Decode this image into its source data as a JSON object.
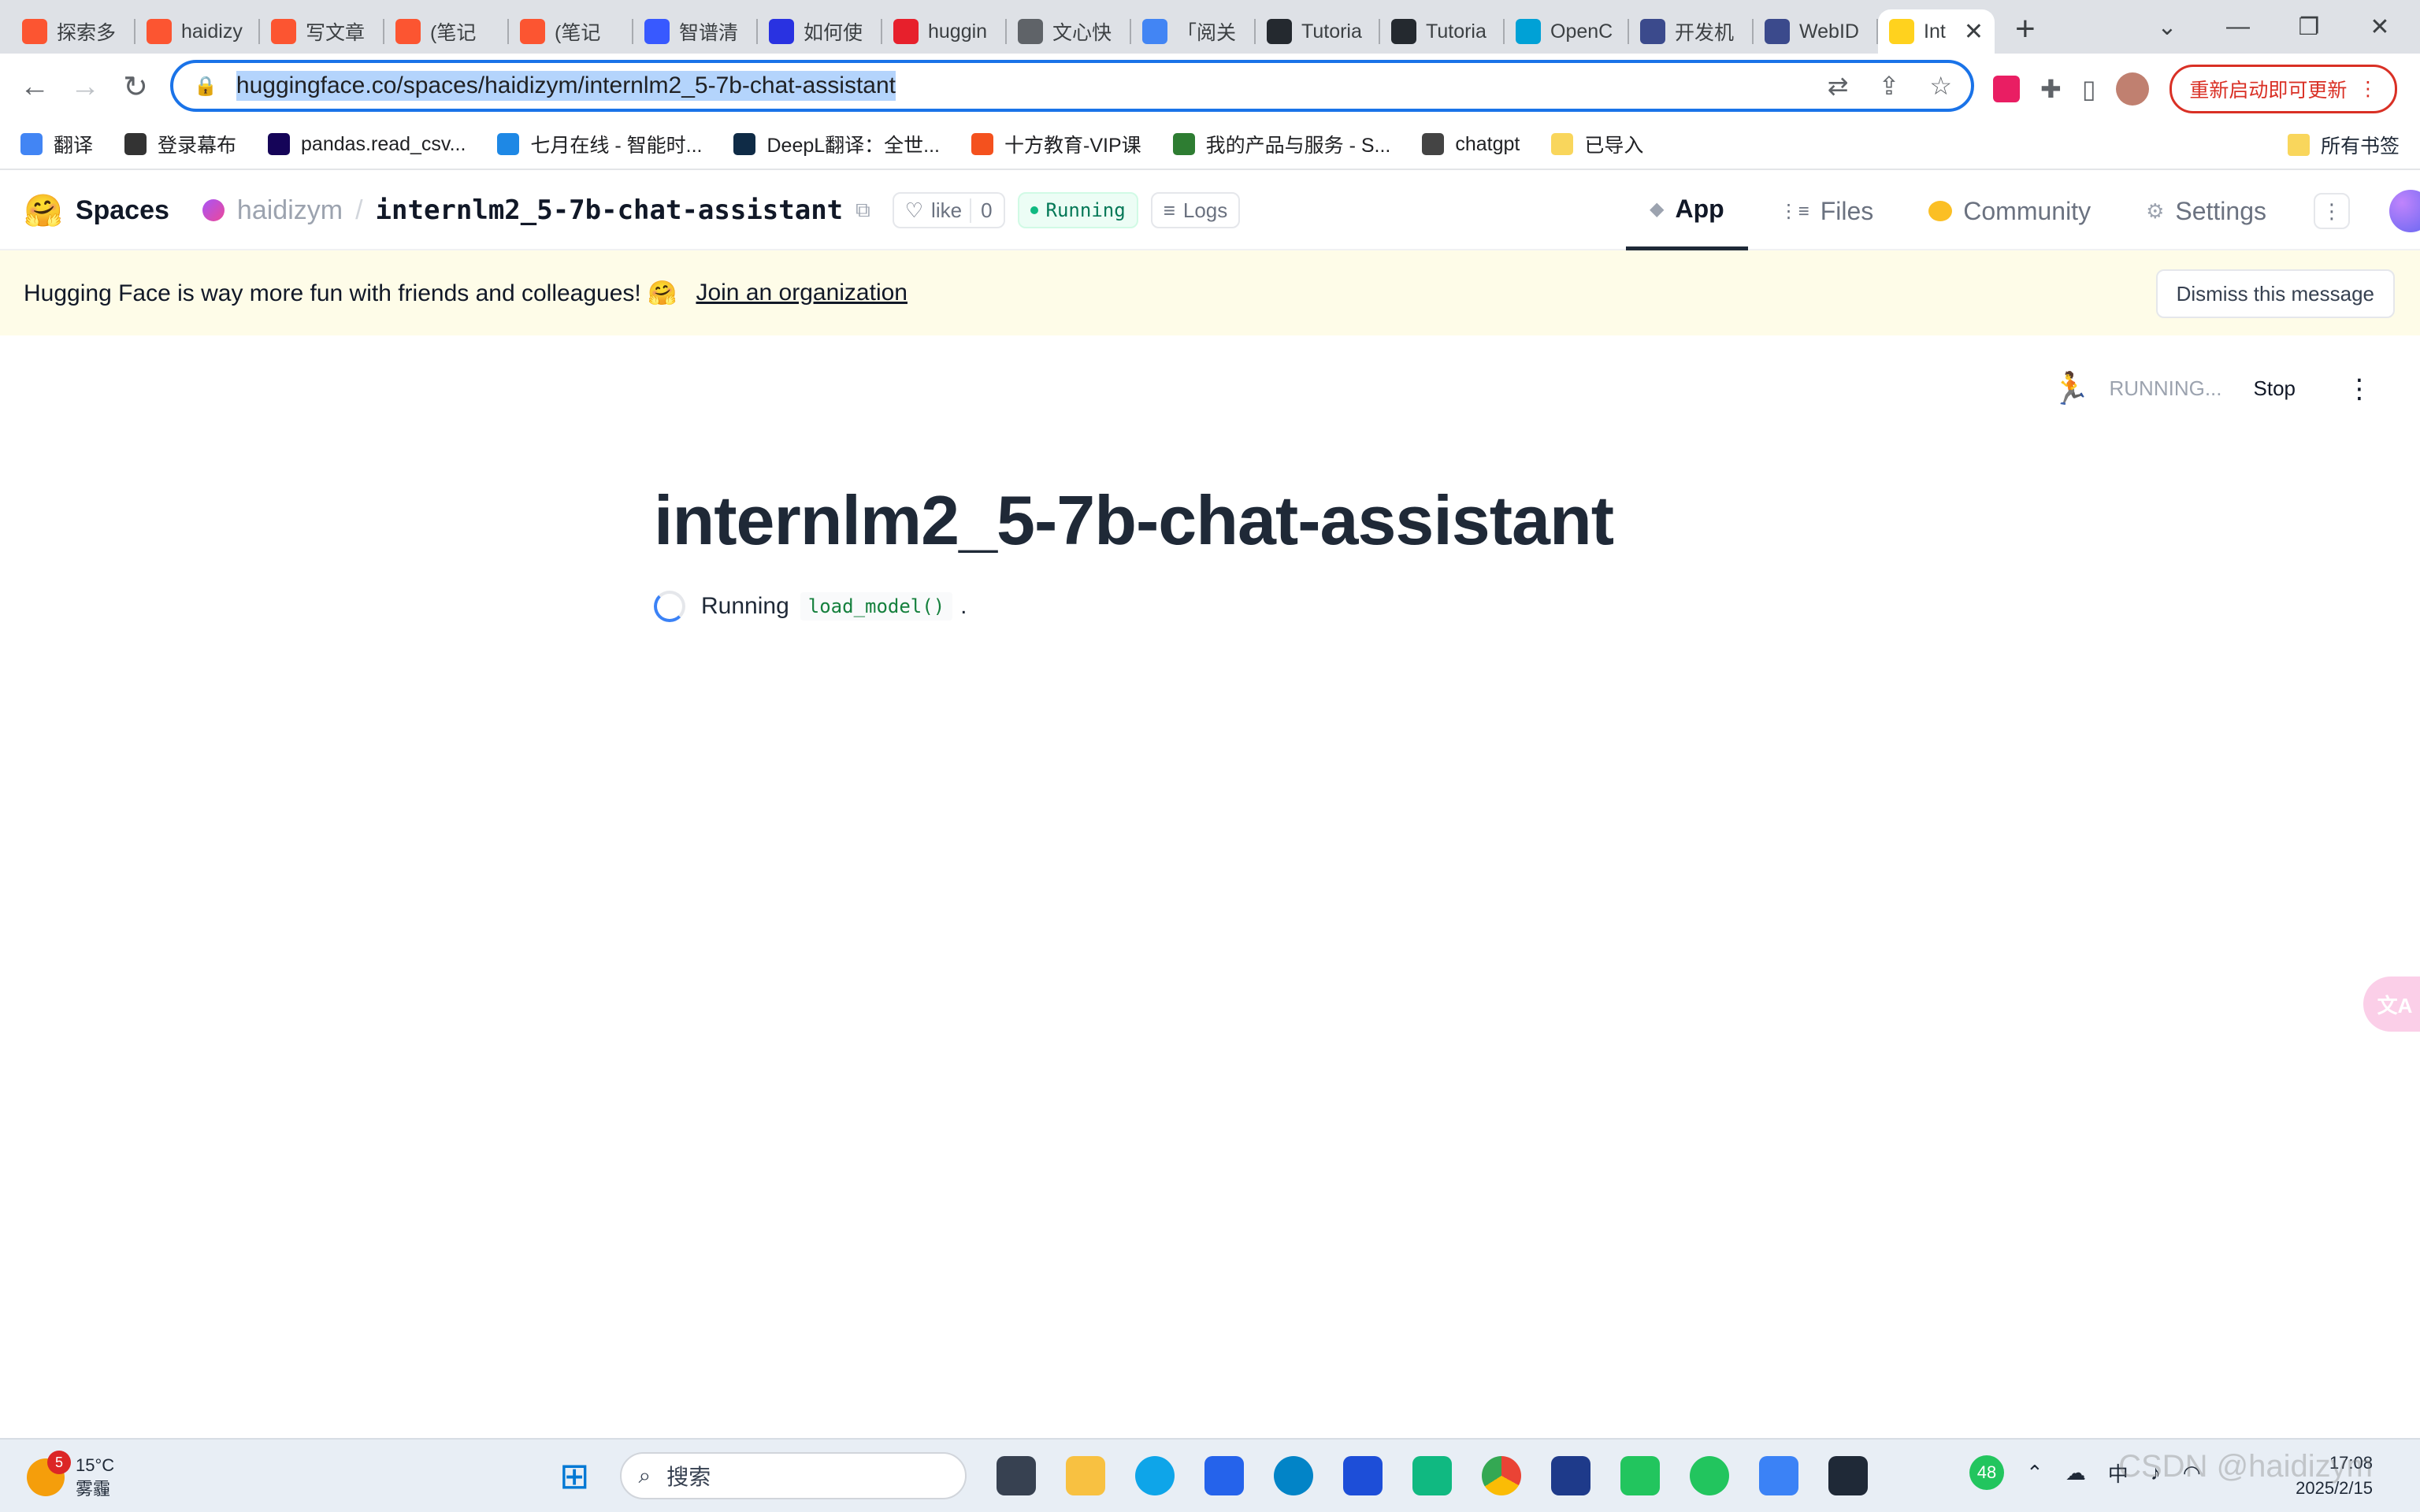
{
  "browser": {
    "tabs": [
      {
        "title": "探索多",
        "icon": "csdn-icon",
        "color": "#fc5531"
      },
      {
        "title": "haidizy",
        "icon": "csdn-icon",
        "color": "#fc5531"
      },
      {
        "title": "写文章",
        "icon": "csdn-icon",
        "color": "#fc5531"
      },
      {
        "title": "(笔记",
        "icon": "csdn-icon",
        "color": "#fc5531"
      },
      {
        "title": "(笔记",
        "icon": "csdn-icon",
        "color": "#fc5531"
      },
      {
        "title": "智谱清",
        "icon": "zhipu-icon",
        "color": "#3859ff"
      },
      {
        "title": "如何使",
        "icon": "baidu-icon",
        "color": "#2932e1"
      },
      {
        "title": "huggin",
        "icon": "51cto-icon",
        "color": "#e7202c"
      },
      {
        "title": "文心快",
        "icon": "globe-icon",
        "color": "#5f6368"
      },
      {
        "title": "「阅关",
        "icon": "docs-icon",
        "color": "#4285f4"
      },
      {
        "title": "Tutoria",
        "icon": "github-icon",
        "color": "#24292f"
      },
      {
        "title": "Tutoria",
        "icon": "github-icon",
        "color": "#24292f"
      },
      {
        "title": "OpenC",
        "icon": "bilibili-icon",
        "color": "#00a1d6"
      },
      {
        "title": "开发机",
        "icon": "intern-icon",
        "color": "#3b4a8c"
      },
      {
        "title": "WebID",
        "icon": "intern-icon",
        "color": "#3b4a8c"
      },
      {
        "title": "Int",
        "icon": "huggingface-icon",
        "color": "#ffd21e",
        "active": true
      }
    ],
    "url": "huggingface.co/spaces/haidizym/internlm2_5-7b-chat-assistant",
    "update_button": "重新启动即可更新",
    "bookmarks": [
      {
        "label": "翻译",
        "color": "#4285f4"
      },
      {
        "label": "登录幕布",
        "color": "#333333"
      },
      {
        "label": "pandas.read_csv...",
        "color": "#150458"
      },
      {
        "label": "七月在线 - 智能时...",
        "color": "#1e88e5"
      },
      {
        "label": "DeepL翻译：全世...",
        "color": "#0f2b46"
      },
      {
        "label": "十方教育-VIP课",
        "color": "#f4511e"
      },
      {
        "label": "我的产品与服务 - S...",
        "color": "#2e7d32"
      },
      {
        "label": "chatgpt",
        "color": "#444444"
      },
      {
        "label": "已导入",
        "color": "#f9d65c"
      }
    ],
    "all_bookmarks": "所有书签"
  },
  "hf": {
    "spaces_label": "Spaces",
    "owner": "haidizym",
    "repo": "internlm2_5-7b-chat-assistant",
    "like_label": "like",
    "like_count": "0",
    "status": "Running",
    "logs_label": "Logs",
    "tabs": {
      "app": "App",
      "files": "Files",
      "community": "Community",
      "settings": "Settings"
    },
    "banner_text": "Hugging Face is way more fun with friends and colleagues! 🤗",
    "banner_link": "Join an organization",
    "dismiss_label": "Dismiss this message"
  },
  "app": {
    "status": "RUNNING...",
    "stop": "Stop",
    "title": "internlm2_5-7b-chat-assistant",
    "running_prefix": "Running",
    "function": "load_model()",
    "suffix": "."
  },
  "taskbar": {
    "weather_temp": "15°C",
    "weather_desc": "雾霾",
    "weather_badge": "5",
    "search": "搜索",
    "tray_number": "48",
    "ime": "中",
    "time": "17:08",
    "date": "2025/2/15",
    "watermark": "CSDN @haidizym"
  }
}
